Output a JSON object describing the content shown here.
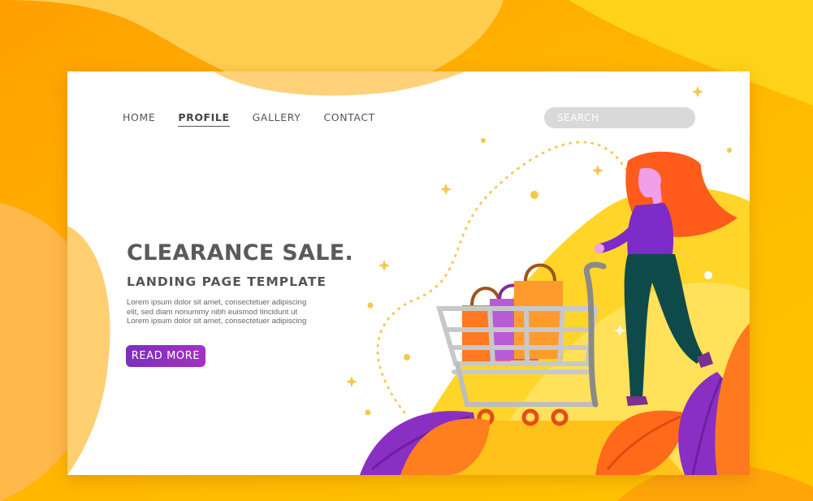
{
  "nav": {
    "items": [
      {
        "label": "HOME",
        "active": false
      },
      {
        "label": "PROFILE",
        "active": true
      },
      {
        "label": "GALLERY",
        "active": false
      },
      {
        "label": "CONTACT",
        "active": false
      }
    ]
  },
  "search": {
    "placeholder": "SEARCH"
  },
  "hero": {
    "title": "CLEARANCE SALE.",
    "subtitle": "LANDING PAGE TEMPLATE",
    "body": "Lorem ipsum dolor sit amet, consectetuer adipiscing elit, sed diam nonummy nibh euismod tincidunt ut Lorem ipsum dolor sit amet, consectetuer adipiscing",
    "cta_label": "READ MORE"
  },
  "colors": {
    "background": "#ffb300",
    "accent_purple": "#8a2fc4",
    "accent_orange": "#ff6a1a",
    "text_dark": "#5a5a5a"
  }
}
